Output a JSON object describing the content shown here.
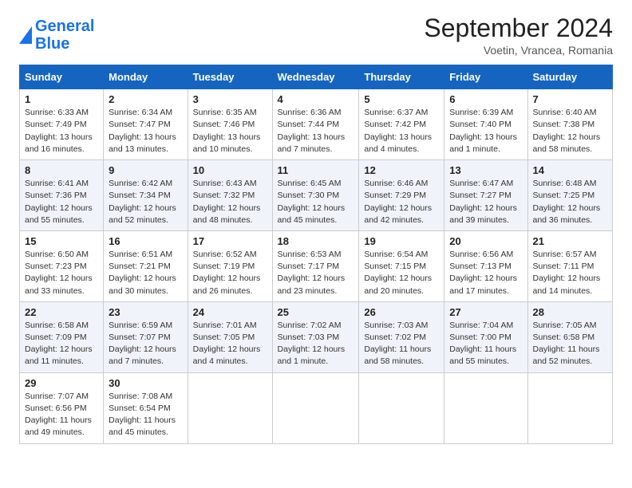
{
  "header": {
    "logo_line1": "General",
    "logo_line2": "Blue",
    "month_title": "September 2024",
    "location": "Voetin, Vrancea, Romania"
  },
  "days_of_week": [
    "Sunday",
    "Monday",
    "Tuesday",
    "Wednesday",
    "Thursday",
    "Friday",
    "Saturday"
  ],
  "weeks": [
    [
      {
        "day": "1",
        "info": "Sunrise: 6:33 AM\nSunset: 7:49 PM\nDaylight: 13 hours\nand 16 minutes."
      },
      {
        "day": "2",
        "info": "Sunrise: 6:34 AM\nSunset: 7:47 PM\nDaylight: 13 hours\nand 13 minutes."
      },
      {
        "day": "3",
        "info": "Sunrise: 6:35 AM\nSunset: 7:46 PM\nDaylight: 13 hours\nand 10 minutes."
      },
      {
        "day": "4",
        "info": "Sunrise: 6:36 AM\nSunset: 7:44 PM\nDaylight: 13 hours\nand 7 minutes."
      },
      {
        "day": "5",
        "info": "Sunrise: 6:37 AM\nSunset: 7:42 PM\nDaylight: 13 hours\nand 4 minutes."
      },
      {
        "day": "6",
        "info": "Sunrise: 6:39 AM\nSunset: 7:40 PM\nDaylight: 13 hours\nand 1 minute."
      },
      {
        "day": "7",
        "info": "Sunrise: 6:40 AM\nSunset: 7:38 PM\nDaylight: 12 hours\nand 58 minutes."
      }
    ],
    [
      {
        "day": "8",
        "info": "Sunrise: 6:41 AM\nSunset: 7:36 PM\nDaylight: 12 hours\nand 55 minutes."
      },
      {
        "day": "9",
        "info": "Sunrise: 6:42 AM\nSunset: 7:34 PM\nDaylight: 12 hours\nand 52 minutes."
      },
      {
        "day": "10",
        "info": "Sunrise: 6:43 AM\nSunset: 7:32 PM\nDaylight: 12 hours\nand 48 minutes."
      },
      {
        "day": "11",
        "info": "Sunrise: 6:45 AM\nSunset: 7:30 PM\nDaylight: 12 hours\nand 45 minutes."
      },
      {
        "day": "12",
        "info": "Sunrise: 6:46 AM\nSunset: 7:29 PM\nDaylight: 12 hours\nand 42 minutes."
      },
      {
        "day": "13",
        "info": "Sunrise: 6:47 AM\nSunset: 7:27 PM\nDaylight: 12 hours\nand 39 minutes."
      },
      {
        "day": "14",
        "info": "Sunrise: 6:48 AM\nSunset: 7:25 PM\nDaylight: 12 hours\nand 36 minutes."
      }
    ],
    [
      {
        "day": "15",
        "info": "Sunrise: 6:50 AM\nSunset: 7:23 PM\nDaylight: 12 hours\nand 33 minutes."
      },
      {
        "day": "16",
        "info": "Sunrise: 6:51 AM\nSunset: 7:21 PM\nDaylight: 12 hours\nand 30 minutes."
      },
      {
        "day": "17",
        "info": "Sunrise: 6:52 AM\nSunset: 7:19 PM\nDaylight: 12 hours\nand 26 minutes."
      },
      {
        "day": "18",
        "info": "Sunrise: 6:53 AM\nSunset: 7:17 PM\nDaylight: 12 hours\nand 23 minutes."
      },
      {
        "day": "19",
        "info": "Sunrise: 6:54 AM\nSunset: 7:15 PM\nDaylight: 12 hours\nand 20 minutes."
      },
      {
        "day": "20",
        "info": "Sunrise: 6:56 AM\nSunset: 7:13 PM\nDaylight: 12 hours\nand 17 minutes."
      },
      {
        "day": "21",
        "info": "Sunrise: 6:57 AM\nSunset: 7:11 PM\nDaylight: 12 hours\nand 14 minutes."
      }
    ],
    [
      {
        "day": "22",
        "info": "Sunrise: 6:58 AM\nSunset: 7:09 PM\nDaylight: 12 hours\nand 11 minutes."
      },
      {
        "day": "23",
        "info": "Sunrise: 6:59 AM\nSunset: 7:07 PM\nDaylight: 12 hours\nand 7 minutes."
      },
      {
        "day": "24",
        "info": "Sunrise: 7:01 AM\nSunset: 7:05 PM\nDaylight: 12 hours\nand 4 minutes."
      },
      {
        "day": "25",
        "info": "Sunrise: 7:02 AM\nSunset: 7:03 PM\nDaylight: 12 hours\nand 1 minute."
      },
      {
        "day": "26",
        "info": "Sunrise: 7:03 AM\nSunset: 7:02 PM\nDaylight: 11 hours\nand 58 minutes."
      },
      {
        "day": "27",
        "info": "Sunrise: 7:04 AM\nSunset: 7:00 PM\nDaylight: 11 hours\nand 55 minutes."
      },
      {
        "day": "28",
        "info": "Sunrise: 7:05 AM\nSunset: 6:58 PM\nDaylight: 11 hours\nand 52 minutes."
      }
    ],
    [
      {
        "day": "29",
        "info": "Sunrise: 7:07 AM\nSunset: 6:56 PM\nDaylight: 11 hours\nand 49 minutes."
      },
      {
        "day": "30",
        "info": "Sunrise: 7:08 AM\nSunset: 6:54 PM\nDaylight: 11 hours\nand 45 minutes."
      },
      {
        "day": "",
        "info": ""
      },
      {
        "day": "",
        "info": ""
      },
      {
        "day": "",
        "info": ""
      },
      {
        "day": "",
        "info": ""
      },
      {
        "day": "",
        "info": ""
      }
    ]
  ]
}
